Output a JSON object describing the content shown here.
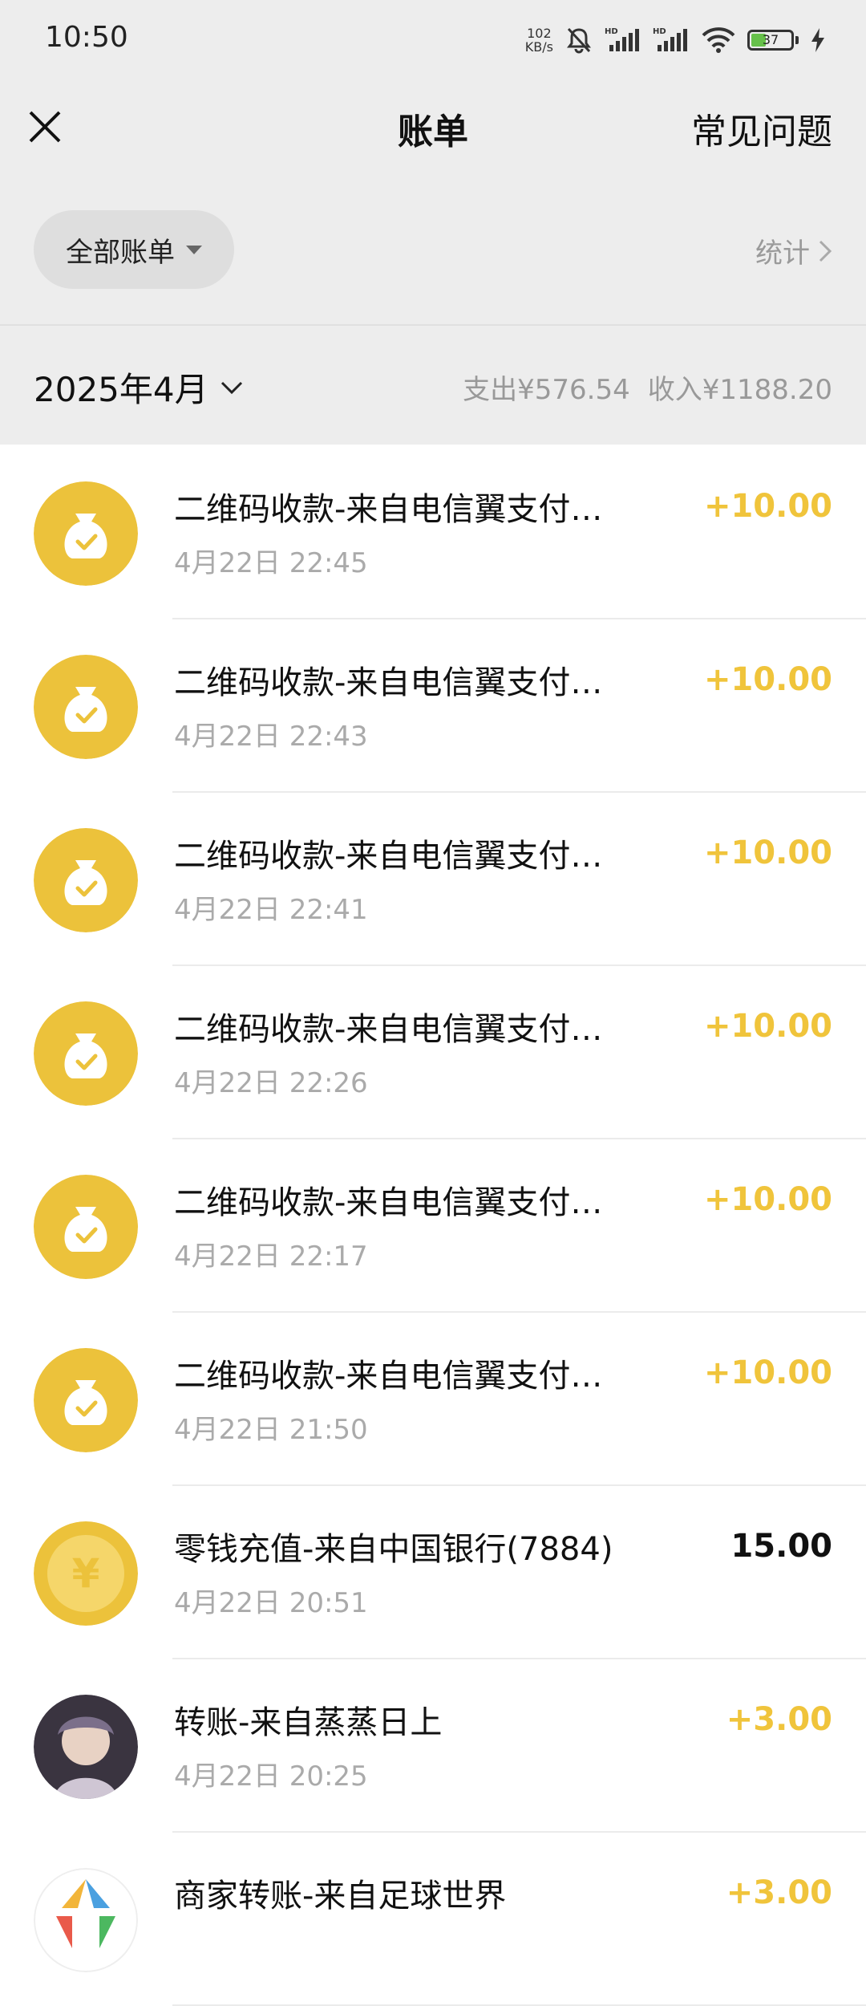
{
  "status": {
    "time": "10:50",
    "netspeed_value": "102",
    "netspeed_unit": "KB/s",
    "battery": "37",
    "battery_level": 0.37
  },
  "nav": {
    "title": "账单",
    "faq": "常见问题"
  },
  "filter": {
    "label": "全部账单",
    "stats": "统计"
  },
  "month": {
    "label": "2025年4月",
    "expense": "支出¥576.54",
    "income": "收入¥1188.20"
  },
  "colors": {
    "income": "#f0c43b",
    "icon_bg": "#ecc23b",
    "background": "#ededed"
  },
  "transactions": [
    {
      "icon": "money-bag-icon",
      "title": "二维码收款-来自电信翼支付…",
      "time": "4月22日 22:45",
      "amount": "+10.00",
      "kind": "income"
    },
    {
      "icon": "money-bag-icon",
      "title": "二维码收款-来自电信翼支付…",
      "time": "4月22日 22:43",
      "amount": "+10.00",
      "kind": "income"
    },
    {
      "icon": "money-bag-icon",
      "title": "二维码收款-来自电信翼支付…",
      "time": "4月22日 22:41",
      "amount": "+10.00",
      "kind": "income"
    },
    {
      "icon": "money-bag-icon",
      "title": "二维码收款-来自电信翼支付…",
      "time": "4月22日 22:26",
      "amount": "+10.00",
      "kind": "income"
    },
    {
      "icon": "money-bag-icon",
      "title": "二维码收款-来自电信翼支付…",
      "time": "4月22日 22:17",
      "amount": "+10.00",
      "kind": "income"
    },
    {
      "icon": "money-bag-icon",
      "title": "二维码收款-来自电信翼支付…",
      "time": "4月22日 21:50",
      "amount": "+10.00",
      "kind": "income"
    },
    {
      "icon": "yuan-coin-icon",
      "title": "零钱充值-来自中国银行(7884)",
      "time": "4月22日 20:51",
      "amount": "15.00",
      "kind": "neutral"
    },
    {
      "icon": "user-avatar",
      "title": "转账-来自蒸蒸日上",
      "time": "4月22日 20:25",
      "amount": "+3.00",
      "kind": "income"
    },
    {
      "icon": "merchant-logo-icon",
      "title": "商家转账-来自足球世界",
      "time": "",
      "amount": "+3.00",
      "kind": "income"
    }
  ]
}
